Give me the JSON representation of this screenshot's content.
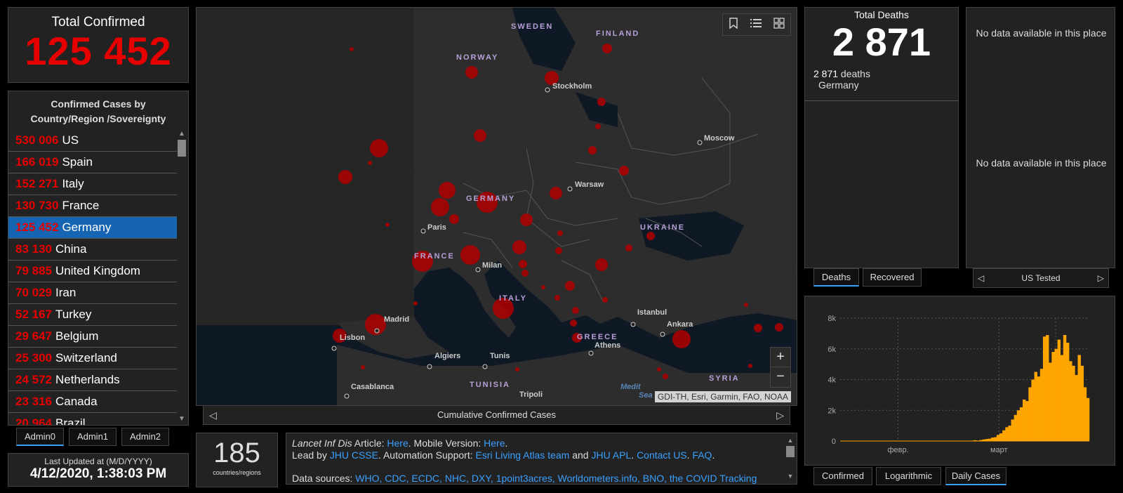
{
  "total_confirmed": {
    "label": "Total Confirmed",
    "value": "125 452"
  },
  "country_list": {
    "header": "Confirmed Cases by Country/Region /Sovereignty",
    "items": [
      {
        "value": "530 006",
        "name": "US",
        "selected": false
      },
      {
        "value": "166 019",
        "name": "Spain",
        "selected": false
      },
      {
        "value": "152 271",
        "name": "Italy",
        "selected": false
      },
      {
        "value": "130 730",
        "name": "France",
        "selected": false
      },
      {
        "value": "125 452",
        "name": "Germany",
        "selected": true
      },
      {
        "value": "83 130",
        "name": "China",
        "selected": false
      },
      {
        "value": "79 885",
        "name": "United Kingdom",
        "selected": false
      },
      {
        "value": "70 029",
        "name": "Iran",
        "selected": false
      },
      {
        "value": "52 167",
        "name": "Turkey",
        "selected": false
      },
      {
        "value": "29 647",
        "name": "Belgium",
        "selected": false
      },
      {
        "value": "25 300",
        "name": "Switzerland",
        "selected": false
      },
      {
        "value": "24 572",
        "name": "Netherlands",
        "selected": false
      },
      {
        "value": "23 316",
        "name": "Canada",
        "selected": false
      },
      {
        "value": "20 964",
        "name": "Brazil",
        "selected": false
      }
    ]
  },
  "admin_tabs": [
    "Admin0",
    "Admin1",
    "Admin2"
  ],
  "last_updated": {
    "label": "Last Updated at (M/D/YYYY)",
    "value": "4/12/2020, 1:38:03 PM"
  },
  "map": {
    "caption": "Cumulative Confirmed Cases",
    "attribution": "GDI-TH, Esri, Garmin, FAO, NOAA",
    "zoom_in": "+",
    "zoom_out": "−",
    "labels": {
      "sweden": "SWEDEN",
      "finland": "FINLAND",
      "norway": "NORWAY",
      "stockholm": "Stockholm",
      "moscow": "Moscow",
      "warsaw": "Warsaw",
      "germany": "GERMANY",
      "ukraine": "UKRAINE",
      "paris": "Paris",
      "france": "FRANCE",
      "milan": "Milan",
      "italy": "ITALY",
      "madrid": "Madrid",
      "lisbon": "Lisbon",
      "istanbul": "Istanbul",
      "ankara": "Ankara",
      "greece": "GREECE",
      "athens": "Athens",
      "algiers": "Algiers",
      "tunis": "Tunis",
      "tunisia": "TUNISIA",
      "casablanca": "Casablanca",
      "tripoli": "Tripoli",
      "syria": "SYRIA",
      "medit": "Medit",
      "sea": "Sea"
    }
  },
  "countries_count": {
    "value": "185",
    "label": "countries/regions"
  },
  "info": {
    "line1_prefix": "Lancet Inf Dis",
    "line1_article": " Article: ",
    "here1": "Here",
    "mobile": ". Mobile Version: ",
    "here2": "Here",
    "dot": ".",
    "lead_by": "Lead by ",
    "jhu_csse": "JHU CSSE",
    "automation": ". Automation Support: ",
    "esri": "Esri Living Atlas team",
    "and": " and ",
    "jhu_apl": "JHU APL",
    "dot2": ". ",
    "contact": "Contact US",
    "dot3": ". ",
    "faq": "FAQ",
    "dot4": ".",
    "sources_label": "Data sources: ",
    "sources": "WHO, CDC, ECDC, NHC, DXY, 1point3acres, Worldometers.info, BNO, the COVID Tracking"
  },
  "deaths": {
    "label": "Total Deaths",
    "value": "2 871",
    "detail_value": "2 871",
    "detail_word": " deaths",
    "detail_place": "Germany"
  },
  "death_tabs": [
    "Deaths",
    "Recovered"
  ],
  "tested": {
    "no_data_1": "No data available in this place",
    "no_data_2": "No data available in this place",
    "nav_label": "US Tested"
  },
  "chart_tabs": [
    "Confirmed",
    "Logarithmic",
    "Daily Cases"
  ],
  "chart_data": {
    "type": "bar",
    "title": "",
    "xlabel": "",
    "ylabel": "",
    "x_tick_labels": [
      "февр.",
      "март"
    ],
    "y_tick_labels": [
      "0",
      "2k",
      "4k",
      "6k",
      "8k"
    ],
    "ylim": [
      0,
      8000
    ],
    "grid": true,
    "color": "#ffa500",
    "values": [
      0,
      0,
      0,
      0,
      0,
      0,
      0,
      0,
      0,
      0,
      0,
      0,
      0,
      0,
      0,
      0,
      0,
      0,
      0,
      0,
      0,
      0,
      0,
      0,
      0,
      0,
      0,
      0,
      0,
      0,
      0,
      0,
      0,
      0,
      0,
      0,
      0,
      0,
      0,
      0,
      0,
      0,
      0,
      0,
      0,
      0,
      50,
      30,
      60,
      100,
      130,
      150,
      220,
      250,
      400,
      500,
      700,
      900,
      1000,
      1400,
      1700,
      2000,
      2200,
      2700,
      2600,
      3500,
      4000,
      4500,
      4200,
      4700,
      6800,
      6900,
      5100,
      5800,
      6000,
      6600,
      5600,
      6900,
      6400,
      5200,
      4900,
      4300,
      5600,
      4900,
      3500,
      2800
    ]
  }
}
